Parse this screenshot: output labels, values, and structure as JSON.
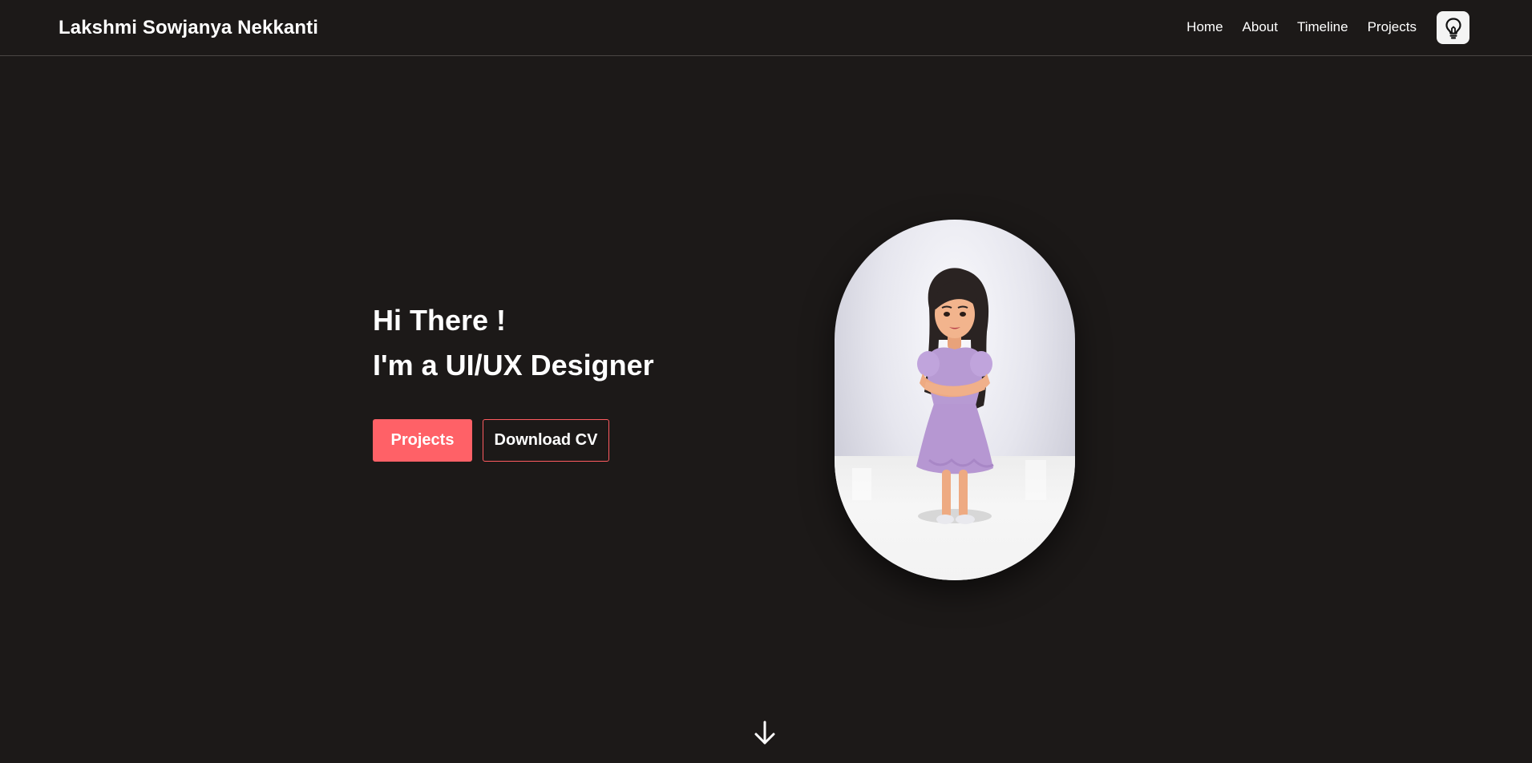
{
  "header": {
    "brand": "Lakshmi Sowjanya Nekkanti",
    "nav": [
      "Home",
      "About",
      "Timeline",
      "Projects"
    ],
    "theme_icon": "lightbulb-icon"
  },
  "hero": {
    "greeting": "Hi There !",
    "headline": "I'm a UI/UX Designer",
    "primary_button": "Projects",
    "secondary_button": "Download CV",
    "avatar_icon": "avatar-image",
    "scroll_icon": "arrow-down-icon"
  },
  "colors": {
    "background": "#1c1918",
    "accent": "#ff6167",
    "text": "#ffffff"
  }
}
